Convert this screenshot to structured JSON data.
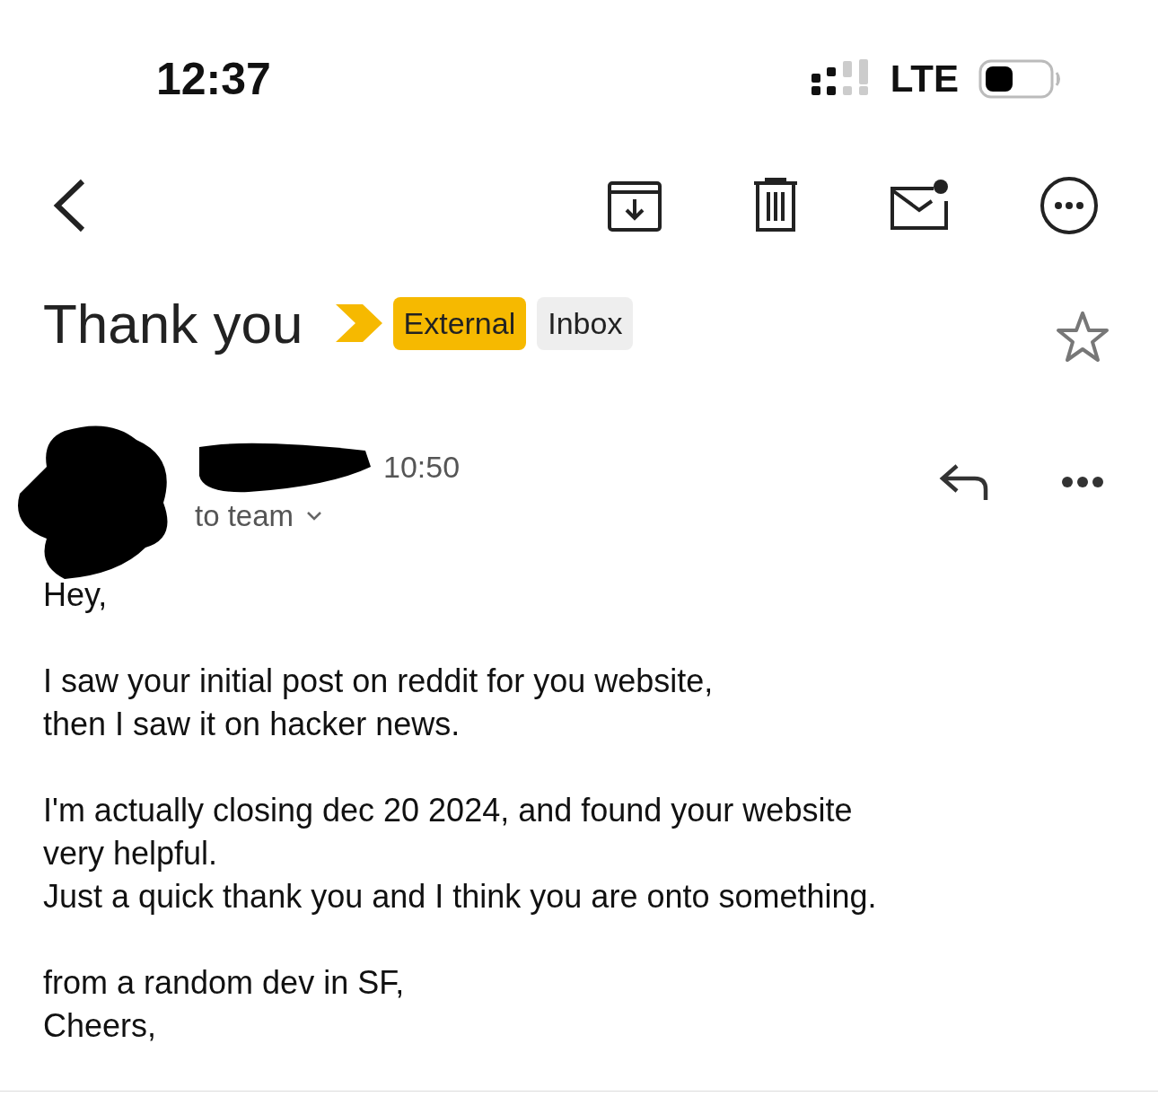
{
  "status_bar": {
    "time": "12:37",
    "network": "LTE"
  },
  "email": {
    "subject": "Thank you",
    "important": true,
    "starred": false,
    "labels": [
      {
        "text": "External",
        "color": "#f6b900"
      },
      {
        "text": "Inbox",
        "color": "#eeeeee"
      }
    ],
    "time": "10:50",
    "recipients": "to team",
    "paragraphs": [
      [
        "Hey,"
      ],
      [
        "I saw your initial post on reddit for you website,",
        "then I saw it on hacker news."
      ],
      [
        "I'm actually closing dec 20 2024, and found your website",
        "very helpful.",
        "Just a quick thank you and I think you are onto something."
      ],
      [
        "from a random dev in SF,",
        "Cheers,"
      ]
    ]
  }
}
